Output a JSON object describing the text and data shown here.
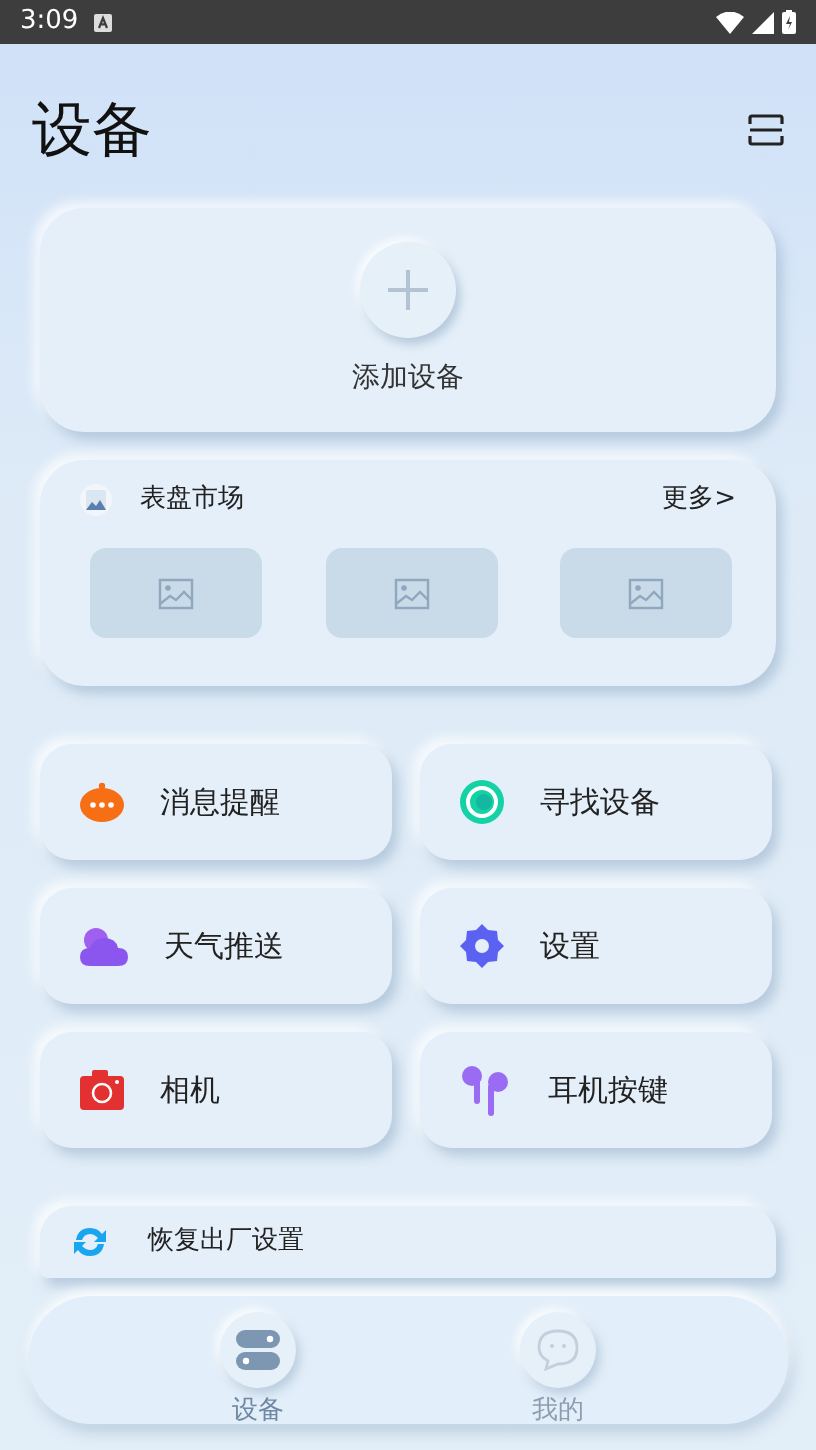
{
  "status_bar": {
    "time": "3:09"
  },
  "header": {
    "title": "设备"
  },
  "add_device": {
    "label": "添加设备"
  },
  "watch_faces": {
    "title": "表盘市场",
    "more": "更多>",
    "thumbnails": [
      {
        "kind": "placeholder"
      },
      {
        "kind": "placeholder"
      },
      {
        "kind": "placeholder"
      }
    ]
  },
  "features": [
    {
      "label": "消息提醒",
      "kind": "message"
    },
    {
      "label": "寻找设备",
      "kind": "find"
    },
    {
      "label": "天气推送",
      "kind": "weather"
    },
    {
      "label": "设置",
      "kind": "settings"
    },
    {
      "label": "相机",
      "kind": "camera"
    },
    {
      "label": "耳机按键",
      "kind": "earbuds"
    }
  ],
  "restore": {
    "label": "恢复出厂设置"
  },
  "bottom_nav": [
    {
      "label": "设备",
      "kind": "devices",
      "selected": true
    },
    {
      "label": "我的",
      "kind": "me",
      "selected": false
    }
  ]
}
